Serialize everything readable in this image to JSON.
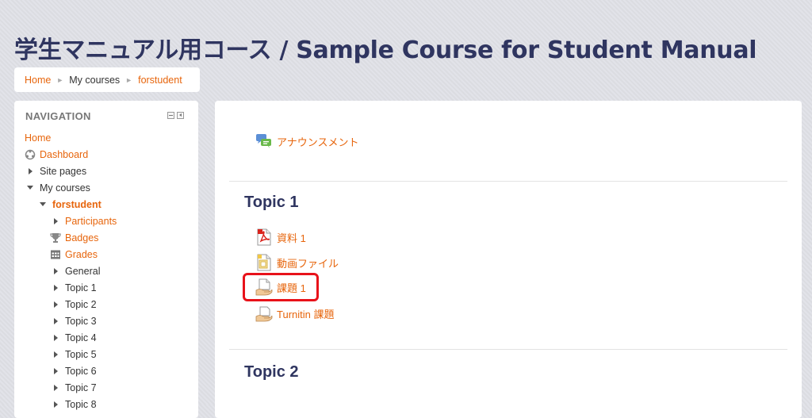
{
  "page": {
    "title": "学生マニュアル用コース / Sample Course for Student Manual"
  },
  "breadcrumb": {
    "home": "Home",
    "my_courses": "My courses",
    "course": "forstudent",
    "separator": "►"
  },
  "navigation": {
    "title": "NAVIGATION",
    "items": [
      {
        "label": "Home"
      },
      {
        "label": "Dashboard"
      },
      {
        "label": "Site pages"
      },
      {
        "label": "My courses"
      },
      {
        "label": "forstudent"
      },
      {
        "label": "Participants"
      },
      {
        "label": "Badges"
      },
      {
        "label": "Grades"
      },
      {
        "label": "General"
      },
      {
        "label": "Topic 1"
      },
      {
        "label": "Topic 2"
      },
      {
        "label": "Topic 3"
      },
      {
        "label": "Topic 4"
      },
      {
        "label": "Topic 5"
      },
      {
        "label": "Topic 6"
      },
      {
        "label": "Topic 7"
      },
      {
        "label": "Topic 8"
      }
    ]
  },
  "main": {
    "general_activity": {
      "label": "アナウンスメント",
      "icon": "forum-icon"
    },
    "sections": [
      {
        "title": "Topic 1",
        "activities": [
          {
            "label": "資料 1",
            "icon": "pdf-icon"
          },
          {
            "label": "動画ファイル",
            "icon": "video-file-icon"
          },
          {
            "label": "課題 1",
            "icon": "assignment-icon"
          },
          {
            "label": "Turnitin 課題",
            "icon": "turnitin-icon"
          }
        ]
      },
      {
        "title": "Topic 2"
      }
    ]
  },
  "colors": {
    "accent": "#e7650c",
    "title": "#2f3560",
    "highlight": "#e8121a"
  }
}
